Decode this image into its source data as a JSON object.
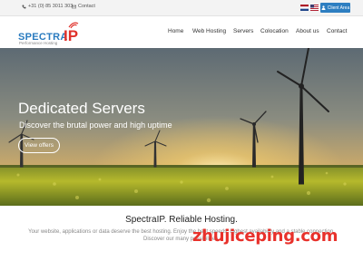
{
  "topbar": {
    "phone": "+31 (0) 85 3011 303",
    "contact": "Contact",
    "client_area": "Client Area",
    "icons": {
      "phone": "phone-icon",
      "contact": "mail-icon",
      "client": "user-icon"
    }
  },
  "logo": {
    "name_part1": "SPECTRA",
    "name_part2": "IP",
    "tagline": "Performance Hosting"
  },
  "nav": {
    "items": [
      "Home",
      "Web Hosting",
      "Servers",
      "Colocation",
      "About us",
      "Contact"
    ]
  },
  "hero": {
    "title": "Dedicated Servers",
    "subtitle": "Discover the brutal power and high uptime",
    "button": "View offers"
  },
  "main": {
    "headline": "SpectraIP. Reliable Hosting.",
    "line1": "Your website, applications or data deserve the best hosting. Enjoy the best speeds, highest availability and a stable connection.",
    "line2": "Discover our many possibilities."
  },
  "watermark": "zhujiceping.com",
  "colors": {
    "brand_blue": "#2a7bbf",
    "brand_red": "#e0312a",
    "client_button": "#2d7ec1"
  }
}
